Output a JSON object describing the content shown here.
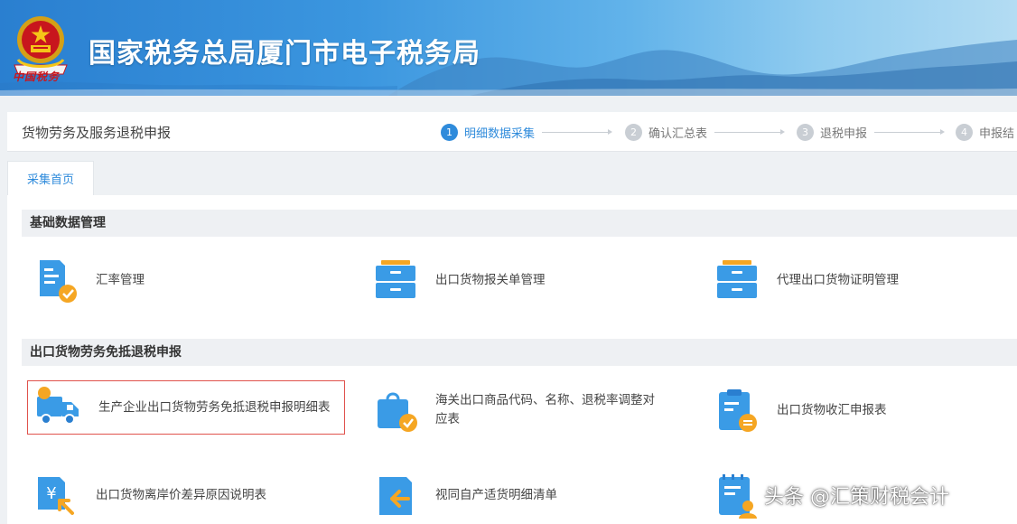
{
  "header": {
    "title": "国家税务总局厦门市电子税务局",
    "emblem_caption": "中国税务"
  },
  "stepbar": {
    "page_name": "货物劳务及服务退税申报",
    "steps": [
      {
        "num": "1",
        "label": "明细数据采集"
      },
      {
        "num": "2",
        "label": "确认汇总表"
      },
      {
        "num": "3",
        "label": "退税申报"
      },
      {
        "num": "4",
        "label": "申报结"
      }
    ]
  },
  "tabs": [
    {
      "label": "采集首页"
    }
  ],
  "sections": [
    {
      "title": "基础数据管理",
      "items": [
        {
          "label": "汇率管理",
          "icon": "document-check-icon"
        },
        {
          "label": "出口货物报关单管理",
          "icon": "drawer-cabinet-icon"
        },
        {
          "label": "代理出口货物证明管理",
          "icon": "drawer-cabinet-icon"
        }
      ]
    },
    {
      "title": "出口货物劳务免抵退税申报",
      "items": [
        {
          "label": "生产企业出口货物劳务免抵退税申报明细表",
          "icon": "delivery-truck-icon"
        },
        {
          "label": "海关出口商品代码、名称、退税率调整对应表",
          "icon": "shopping-bag-icon"
        },
        {
          "label": "出口货物收汇申报表",
          "icon": "clipboard-money-icon"
        },
        {
          "label": "出口货物离岸价差异原因说明表",
          "icon": "yuan-document-icon"
        },
        {
          "label": "视同自产适货明细清单",
          "icon": "folder-arrow-icon"
        },
        {
          "label": "",
          "icon": "calendar-person-icon"
        }
      ]
    }
  ],
  "watermark": "头条 @汇策财税会计",
  "colors": {
    "accent": "#2f8bdb",
    "icon_blue": "#3a9be6",
    "icon_orange": "#f5a623",
    "highlight_border": "#e0524c"
  }
}
